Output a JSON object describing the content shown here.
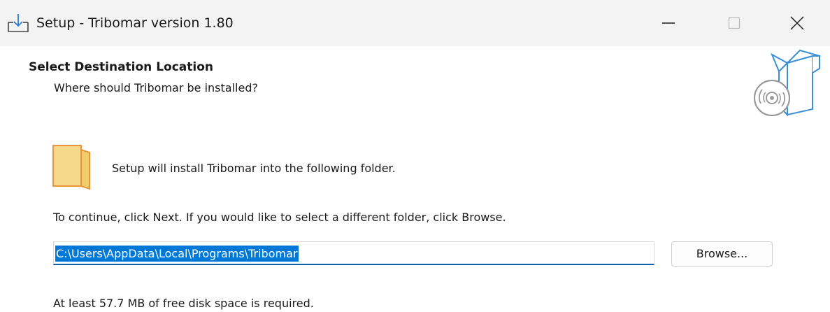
{
  "window": {
    "title": "Setup - Tribomar version 1.80"
  },
  "header": {
    "title": "Select Destination Location",
    "subtitle": "Where should Tribomar be installed?"
  },
  "main": {
    "install_text": "Setup will install Tribomar into the following folder.",
    "instruction": "To continue, click Next. If you would like to select a different folder, click Browse.",
    "path_value": "C:\\Users\\AppData\\Local\\Programs\\Tribomar",
    "browse_label": "Browse...",
    "disk_space": "At least 57.7 MB of free disk space is required."
  },
  "icons": {
    "app": "download-icon",
    "minimize": "minimize-icon",
    "maximize": "maximize-icon",
    "close": "close-icon",
    "wizard": "software-box-icon",
    "folder": "folder-icon"
  },
  "colors": {
    "selection": "#0078d7",
    "focus_underline": "#0a5fb4",
    "folder": "#f6d98a",
    "folder_outline": "#e8963e",
    "wizard_box": "#3a8fd8"
  }
}
